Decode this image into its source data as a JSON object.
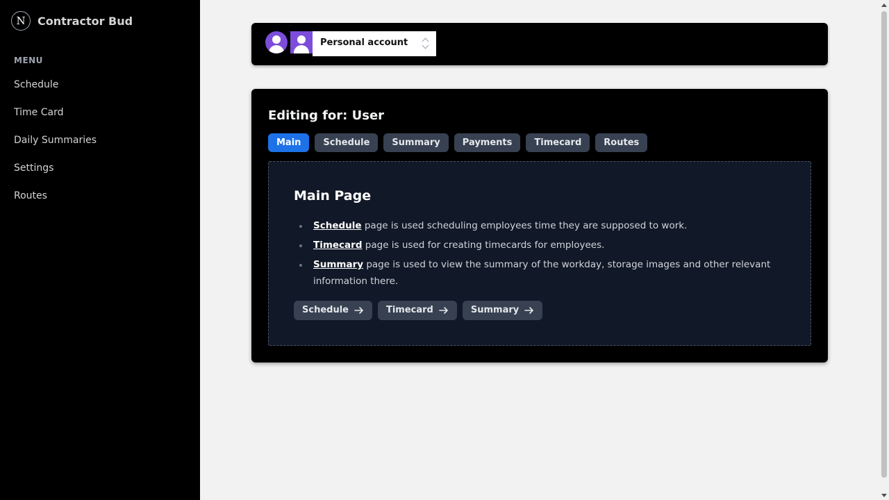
{
  "sidebar": {
    "brand": {
      "logo_letter": "N",
      "name": "Contractor Bud"
    },
    "menu_heading": "MENU",
    "items": [
      {
        "label": "Schedule"
      },
      {
        "label": "Time Card"
      },
      {
        "label": "Daily Summaries"
      },
      {
        "label": "Settings"
      },
      {
        "label": "Routes"
      }
    ]
  },
  "account": {
    "selected": "Personal account",
    "avatar_color": "#7c4ddb"
  },
  "editor": {
    "title": "Editing for: User",
    "tabs": [
      {
        "label": "Main",
        "active": true
      },
      {
        "label": "Schedule",
        "active": false
      },
      {
        "label": "Summary",
        "active": false
      },
      {
        "label": "Payments",
        "active": false
      },
      {
        "label": "Timecard",
        "active": false
      },
      {
        "label": "Routes",
        "active": false
      }
    ],
    "panel": {
      "title": "Main Page",
      "items": [
        {
          "link": "Schedule",
          "text": " page is used scheduling employees time they are supposed to work."
        },
        {
          "link": "Timecard",
          "text": " page is used for creating timecards for employees."
        },
        {
          "link": "Summary",
          "text": " page is used to view the summary of the workday, storage images and other relevant information there."
        }
      ],
      "buttons": [
        {
          "label": "Schedule",
          "icon": "arrow-right-icon"
        },
        {
          "label": "Timecard",
          "icon": "arrow-right-icon"
        },
        {
          "label": "Summary",
          "icon": "arrow-right-icon"
        }
      ]
    }
  },
  "colors": {
    "accent": "#1d72e8",
    "sidebar_bg": "#000000",
    "page_bg": "#f2f2f2",
    "panel_bg": "#111827",
    "tab_bg": "#374151"
  }
}
